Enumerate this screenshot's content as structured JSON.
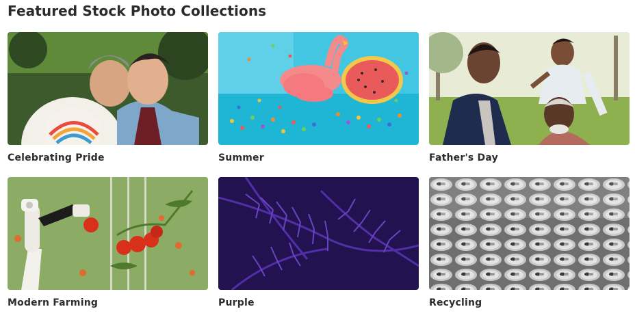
{
  "section": {
    "title": "Featured Stock Photo Collections"
  },
  "collections": [
    {
      "label": "Celebrating Pride",
      "image": "pride-couple-photo"
    },
    {
      "label": "Summer",
      "image": "pool-floats-photo"
    },
    {
      "label": "Father's Day",
      "image": "fathers-day-photo"
    },
    {
      "label": "Modern Farming",
      "image": "robot-tomato-photo"
    },
    {
      "label": "Purple",
      "image": "purple-fern-photo"
    },
    {
      "label": "Recycling",
      "image": "aluminum-cans-photo"
    }
  ],
  "colors": {
    "title": "#2a2a2a",
    "caption": "#2d2d2d",
    "pool": "#1fb6d6",
    "fern": "#4b2a9c",
    "tomato": "#d9301c"
  }
}
